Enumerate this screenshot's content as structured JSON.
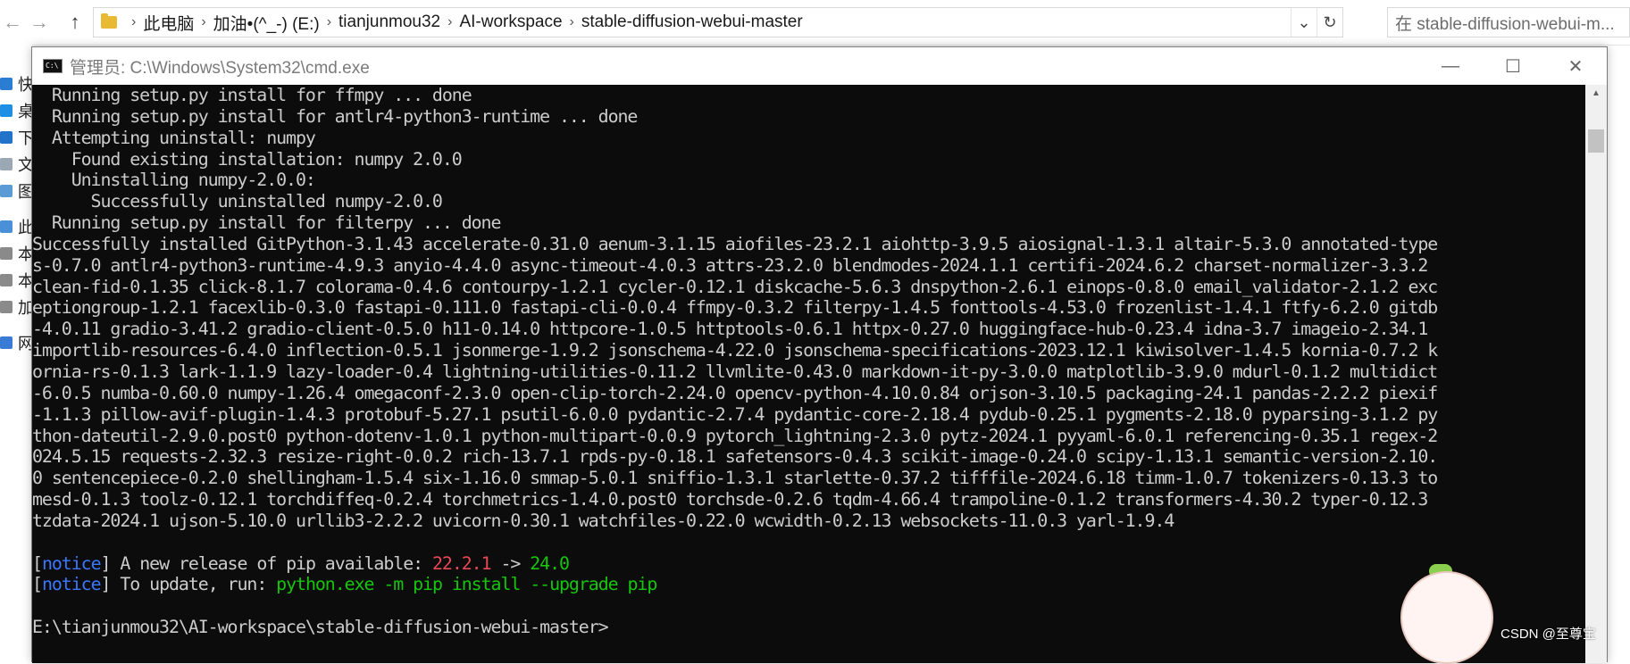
{
  "explorer": {
    "back_icon": "back-arrow",
    "forward_icon": "forward-arrow",
    "up_icon": "up-arrow",
    "breadcrumbs": [
      "此电脑",
      "加油•(^_-) (E:)",
      "tianjunmou32",
      "AI-workspace",
      "stable-diffusion-webui-master"
    ],
    "search_placeholder": "在 stable-diffusion-webui-m...",
    "left_pane": [
      "快",
      "桌",
      "下",
      "文",
      "图",
      "此",
      "本",
      "本",
      "加",
      "网"
    ]
  },
  "cmd": {
    "title": "管理员: C:\\Windows\\System32\\cmd.exe",
    "icon_text": "C:\\",
    "minimize": "—",
    "maximize": "☐",
    "close": "✕",
    "lines": [
      "  Running setup.py install for ffmpy ... done",
      "  Running setup.py install for antlr4-python3-runtime ... done",
      "  Attempting uninstall: numpy",
      "    Found existing installation: numpy 2.0.0",
      "    Uninstalling numpy-2.0.0:",
      "      Successfully uninstalled numpy-2.0.0",
      "  Running setup.py install for filterpy ... done",
      "Successfully installed GitPython-3.1.43 accelerate-0.31.0 aenum-3.1.15 aiofiles-23.2.1 aiohttp-3.9.5 aiosignal-1.3.1 altair-5.3.0 annotated-type",
      "s-0.7.0 antlr4-python3-runtime-4.9.3 anyio-4.4.0 async-timeout-4.0.3 attrs-23.2.0 blendmodes-2024.1.1 certifi-2024.6.2 charset-normalizer-3.3.2",
      "clean-fid-0.1.35 click-8.1.7 colorama-0.4.6 contourpy-1.2.1 cycler-0.12.1 diskcache-5.6.3 dnspython-2.6.1 einops-0.8.0 email_validator-2.1.2 exc",
      "eptiongroup-1.2.1 facexlib-0.3.0 fastapi-0.111.0 fastapi-cli-0.0.4 ffmpy-0.3.2 filterpy-1.4.5 fonttools-4.53.0 frozenlist-1.4.1 ftfy-6.2.0 gitdb",
      "-4.0.11 gradio-3.41.2 gradio-client-0.5.0 h11-0.14.0 httpcore-1.0.5 httptools-0.6.1 httpx-0.27.0 huggingface-hub-0.23.4 idna-3.7 imageio-2.34.1",
      "importlib-resources-6.4.0 inflection-0.5.1 jsonmerge-1.9.2 jsonschema-4.22.0 jsonschema-specifications-2023.12.1 kiwisolver-1.4.5 kornia-0.7.2 k",
      "ornia-rs-0.1.3 lark-1.1.9 lazy-loader-0.4 lightning-utilities-0.11.2 llvmlite-0.43.0 markdown-it-py-3.0.0 matplotlib-3.9.0 mdurl-0.1.2 multidict",
      "-6.0.5 numba-0.60.0 numpy-1.26.4 omegaconf-2.3.0 open-clip-torch-2.24.0 opencv-python-4.10.0.84 orjson-3.10.5 packaging-24.1 pandas-2.2.2 piexif",
      "-1.1.3 pillow-avif-plugin-1.4.3 protobuf-5.27.1 psutil-6.0.0 pydantic-2.7.4 pydantic-core-2.18.4 pydub-0.25.1 pygments-2.18.0 pyparsing-3.1.2 py",
      "thon-dateutil-2.9.0.post0 python-dotenv-1.0.1 python-multipart-0.0.9 pytorch_lightning-2.3.0 pytz-2024.1 pyyaml-6.0.1 referencing-0.35.1 regex-2",
      "024.5.15 requests-2.32.3 resize-right-0.0.2 rich-13.7.1 rpds-py-0.18.1 safetensors-0.4.3 scikit-image-0.24.0 scipy-1.13.1 semantic-version-2.10.",
      "0 sentencepiece-0.2.0 shellingham-1.5.4 six-1.16.0 smmap-5.0.1 sniffio-1.3.1 starlette-0.37.2 tifffile-2024.6.18 timm-1.0.7 tokenizers-0.13.3 to",
      "mesd-0.1.3 toolz-0.12.1 torchdiffeq-0.2.4 torchmetrics-1.4.0.post0 torchsde-0.2.6 tqdm-4.66.4 trampoline-0.1.2 transformers-4.30.2 typer-0.12.3",
      "tzdata-2024.1 ujson-5.10.0 urllib3-2.2.2 uvicorn-0.30.1 watchfiles-0.22.0 wcwidth-0.2.13 websockets-11.0.3 yarl-1.9.4"
    ],
    "notice1": {
      "open": "[",
      "tag": "notice",
      "close": "]",
      "text": " A new release of pip available: ",
      "old_version": "22.2.1",
      "arrow": " -> ",
      "new_version": "24.0"
    },
    "notice2": {
      "open": "[",
      "tag": "notice",
      "close": "]",
      "text": " To update, run: ",
      "command": "python.exe -m pip install --upgrade pip"
    },
    "prompt": "E:\\tianjunmou32\\AI-workspace\\stable-diffusion-webui-master>",
    "colors": {
      "background": "#0c0c0c",
      "text": "#cccccc",
      "notice": "#3b78ff",
      "old_version": "#e74856",
      "new_version": "#16c60c"
    }
  },
  "watermark": {
    "text": "CSDN @至尊宝"
  }
}
